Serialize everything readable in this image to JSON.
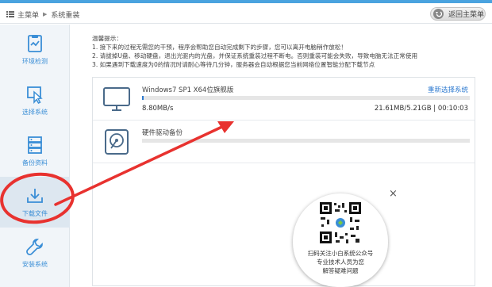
{
  "header": {
    "breadcrumb": [
      "主菜单",
      "系统重装"
    ],
    "back_label": "返回主菜单"
  },
  "sidebar": {
    "items": [
      {
        "label": "环境检测",
        "icon": "environment-check-icon"
      },
      {
        "label": "选择系统",
        "icon": "select-system-icon"
      },
      {
        "label": "备份资料",
        "icon": "backup-data-icon"
      },
      {
        "label": "下载文件",
        "icon": "download-file-icon",
        "active": true
      },
      {
        "label": "安装系统",
        "icon": "install-system-icon"
      }
    ]
  },
  "tips": {
    "heading": "温馨提示：",
    "lines": [
      "1. 接下来的过程无需您的干预，程序会帮助您自动完成剩下的步骤，您可以离开电脑稍作放松！",
      "2. 请拔掉U盘、移动硬盘，退出光驱内的光盘，并保证系统重装过程不断电。否则重装可能会失败，导致电脑无法正常使用",
      "3. 如果遇到下载速度为0的情况时请耐心等待几分钟，服务器会自动根据您当前网络位置智能分配下载节点"
    ]
  },
  "tasks": [
    {
      "title": "Windows7 SP1 X64位旗舰版",
      "link": "重新选择系统",
      "speed": "8.80MB/s",
      "stats": "21.61MB/5.21GB | 00:10:03",
      "progress": 0.004
    },
    {
      "title": "硬件驱动备份",
      "link": "",
      "speed": "",
      "stats": "",
      "progress": 0
    }
  ],
  "close_label": "×",
  "qr_popup": {
    "lines": [
      "扫码关注小白系统公众号",
      "专业技术人员为您",
      "解答疑难问题"
    ]
  },
  "colors": {
    "accent": "#2f7bd0",
    "annotation_red": "#e8322f",
    "sidebar_bg": "#f1f5f9"
  }
}
